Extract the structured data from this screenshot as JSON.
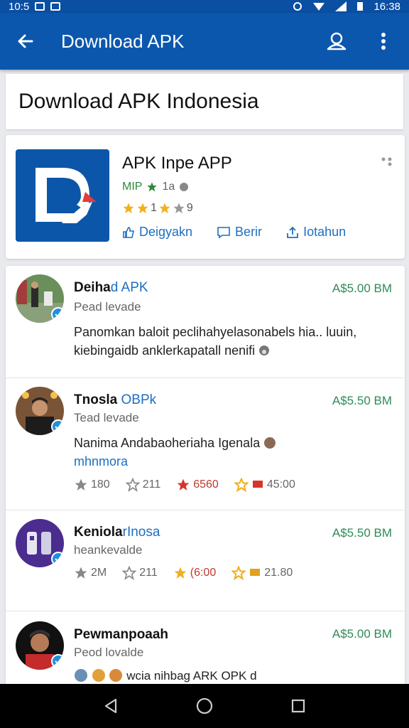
{
  "status": {
    "time_left": "10:5",
    "time_right": "16:38"
  },
  "appbar": {
    "title": "Download APK"
  },
  "header": {
    "title": "Download APK Indonesia"
  },
  "app": {
    "name": "APK Inpe APP",
    "meta_tag": "MIP",
    "meta_value": "1a",
    "rating_text": "1",
    "rating_count": "9",
    "actions": [
      "Deigyakn",
      "Berir",
      "Iotahun"
    ],
    "colors": {
      "brand": "#0c56a9",
      "star": "#f2b01e"
    }
  },
  "reviews": [
    {
      "name": "Deiha",
      "name_highlight": "d APK",
      "price": "A$5.00 BM",
      "sub": "Pead levade",
      "text": "Panomkan baloit peclihahyelasonabels hia.. luuin, kiebingaidb anklerkapatall nenifi"
    },
    {
      "name": "Tnosla",
      "name_highlight": "OBPk",
      "price": "A$5.50 BM",
      "sub": "Tead levade",
      "text": "Nanima Andabaoheriaha Igenala",
      "link": "mhnmora",
      "stats": [
        "180",
        "211",
        "6560",
        "45:00"
      ]
    },
    {
      "name": "Keniola",
      "name_highlight": "rInosa",
      "price": "A$5.50 BM",
      "sub": "heankevalde",
      "stats": [
        "2M",
        "211",
        "(6:00",
        "21.80"
      ]
    },
    {
      "name": "Pewmanpoaah",
      "price": "A$5.00 BM",
      "sub": "Peod lovalde",
      "text": "wcia nihbag ARK OPK d"
    }
  ]
}
